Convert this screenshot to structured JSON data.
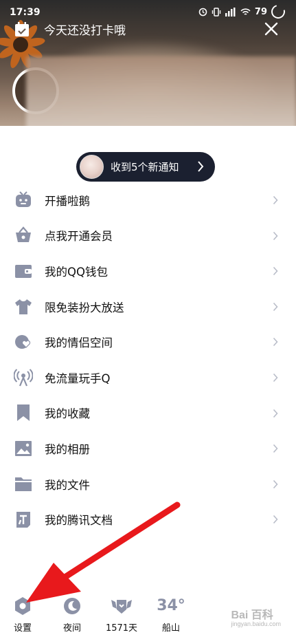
{
  "status_bar": {
    "time": "17:39",
    "battery": "79"
  },
  "header": {
    "checkin_text": "今天还没打卡哦"
  },
  "notification": {
    "text": "收到5个新通知"
  },
  "menu": {
    "items": [
      {
        "label": "开播啦鹅",
        "icon": "tv-robot-icon"
      },
      {
        "label": "点我开通会员",
        "icon": "crown-basket-icon"
      },
      {
        "label": "我的QQ钱包",
        "icon": "wallet-icon"
      },
      {
        "label": "限免装扮大放送",
        "icon": "tshirt-icon"
      },
      {
        "label": "我的情侣空间",
        "icon": "hearts-icon"
      },
      {
        "label": "免流量玩手Q",
        "icon": "antenna-icon"
      },
      {
        "label": "我的收藏",
        "icon": "bookmark-icon"
      },
      {
        "label": "我的相册",
        "icon": "photo-icon"
      },
      {
        "label": "我的文件",
        "icon": "folder-icon"
      },
      {
        "label": "我的腾讯文档",
        "icon": "document-icon"
      }
    ]
  },
  "bottom_bar": {
    "settings": "设置",
    "night": "夜间",
    "days": "1571天",
    "temperature": "34°",
    "city": "船山"
  },
  "watermark": {
    "brand": "Bai 百科",
    "sub": "jingyan.baidu.com"
  },
  "colors": {
    "icon_gray": "#8b91a6",
    "pill_bg": "#1b2030",
    "arrow_red": "#e8191c"
  }
}
